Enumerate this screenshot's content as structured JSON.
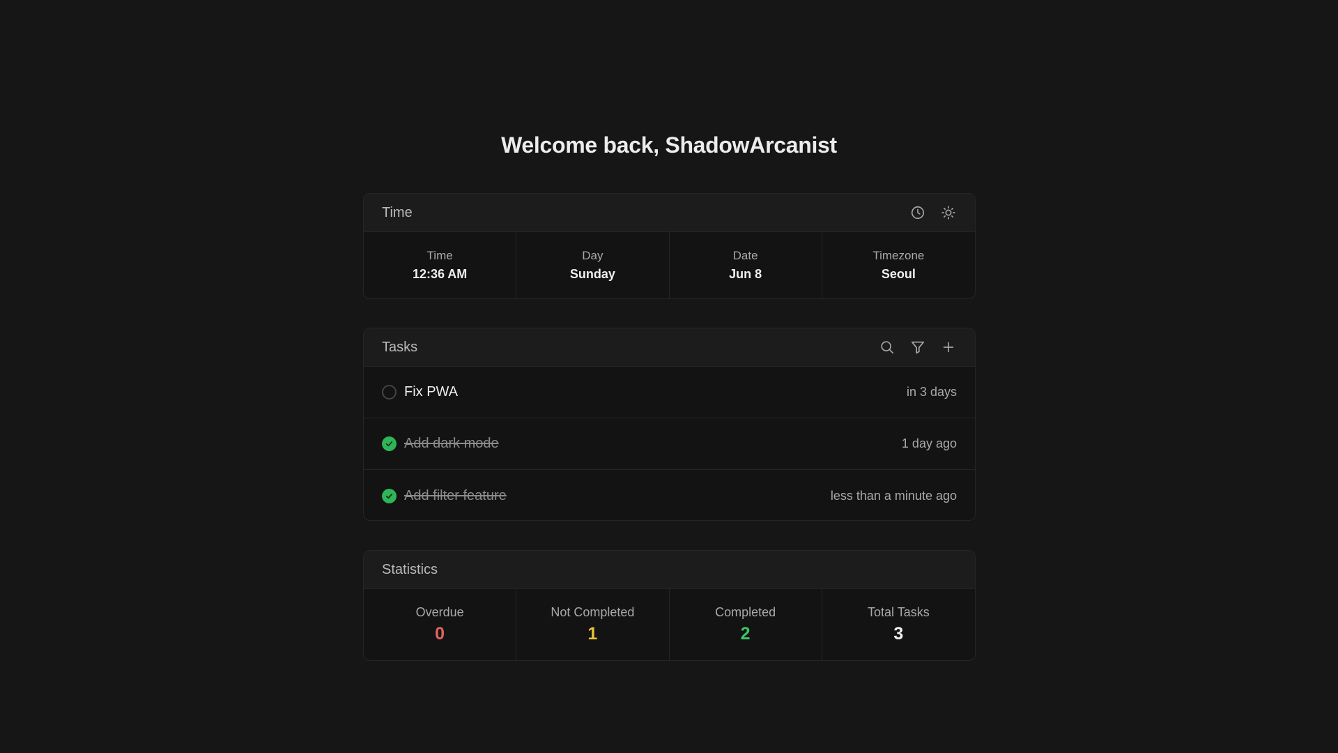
{
  "greeting": "Welcome back, ShadowArcanist",
  "time_card": {
    "title": "Time",
    "icons": [
      "clock-icon",
      "sun-icon"
    ],
    "cells": [
      {
        "label": "Time",
        "value": "12:36 AM"
      },
      {
        "label": "Day",
        "value": "Sunday"
      },
      {
        "label": "Date",
        "value": "Jun 8"
      },
      {
        "label": "Timezone",
        "value": "Seoul"
      }
    ]
  },
  "tasks_card": {
    "title": "Tasks",
    "icons": [
      "search-icon",
      "filter-icon",
      "plus-icon"
    ],
    "tasks": [
      {
        "name": "Fix PWA",
        "completed": false,
        "when": "in 3 days"
      },
      {
        "name": "Add dark mode",
        "completed": true,
        "when": "1 day ago"
      },
      {
        "name": "Add filter feature",
        "completed": true,
        "when": "less than a minute ago"
      }
    ]
  },
  "stats_card": {
    "title": "Statistics",
    "stats": [
      {
        "label": "Overdue",
        "value": "0",
        "color": "#e06560"
      },
      {
        "label": "Not Completed",
        "value": "1",
        "color": "#e8c03a"
      },
      {
        "label": "Completed",
        "value": "2",
        "color": "#3ec46a"
      },
      {
        "label": "Total Tasks",
        "value": "3",
        "color": "#f0f0f0"
      }
    ]
  },
  "colors": {
    "background": "#161616",
    "card_header": "#1c1c1c",
    "border": "#262626",
    "check_done": "#2fb457"
  }
}
